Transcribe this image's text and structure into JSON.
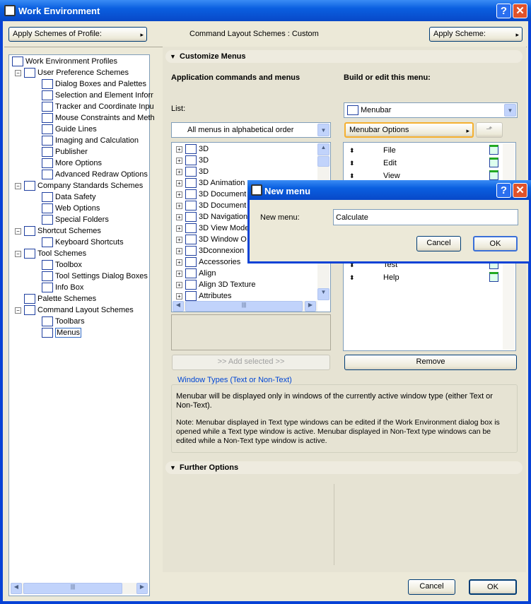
{
  "window": {
    "title": "Work Environment",
    "help": "?",
    "close": "✕"
  },
  "toolbar": {
    "apply_profile": "Apply Schemes of Profile:",
    "layout_status": "Command Layout Schemes : Custom",
    "apply_scheme": "Apply Scheme:"
  },
  "tree": {
    "items": [
      {
        "label": "Work Environment Profiles",
        "level": 0
      },
      {
        "label": "User Preference Schemes",
        "level": 1
      },
      {
        "label": "Dialog Boxes and Palettes",
        "level": 2
      },
      {
        "label": "Selection and Element Inforr",
        "level": 2
      },
      {
        "label": "Tracker and Coordinate Inpu",
        "level": 2
      },
      {
        "label": "Mouse Constraints and Meth",
        "level": 2
      },
      {
        "label": "Guide Lines",
        "level": 2
      },
      {
        "label": "Imaging and Calculation",
        "level": 2
      },
      {
        "label": "Publisher",
        "level": 2
      },
      {
        "label": "More Options",
        "level": 2
      },
      {
        "label": "Advanced Redraw Options",
        "level": 2
      },
      {
        "label": "Company Standards Schemes",
        "level": 1
      },
      {
        "label": "Data Safety",
        "level": 2
      },
      {
        "label": "Web Options",
        "level": 2
      },
      {
        "label": "Special Folders",
        "level": 2
      },
      {
        "label": "Shortcut Schemes",
        "level": 1
      },
      {
        "label": "Keyboard Shortcuts",
        "level": 2
      },
      {
        "label": "Tool Schemes",
        "level": 1
      },
      {
        "label": "Toolbox",
        "level": 2
      },
      {
        "label": "Tool Settings Dialog Boxes",
        "level": 2
      },
      {
        "label": "Info Box",
        "level": 2
      },
      {
        "label": "Palette Schemes",
        "level": 1
      },
      {
        "label": "Command Layout Schemes",
        "level": 1
      },
      {
        "label": "Toolbars",
        "level": 2
      },
      {
        "label": "Menus",
        "level": 2,
        "selected": true
      }
    ]
  },
  "customize": {
    "header": "Customize Menus",
    "left_title": "Application commands and menus",
    "right_title": "Build or edit this menu:",
    "list_label": "List:",
    "list_select": "All menus in alphabetical order",
    "commands": [
      "3D",
      "3D",
      "3D",
      "3D Animation",
      "3D Document",
      "3D Document",
      "3D Navigation",
      "3D View Mode",
      "3D Window O",
      "3Dconnexion",
      "Accessories",
      "Align",
      "Align 3D Texture",
      "Attributes"
    ],
    "add_selected": ">> Add selected >>",
    "menu_select": "Menubar",
    "menu_options": "Menubar Options",
    "menu_items_top": [
      "File",
      "Edit",
      "View"
    ],
    "menu_items_bottom": [
      "Test",
      "Help"
    ],
    "remove": "Remove",
    "group_title": "Window Types (Text or Non-Text)",
    "group_text1": "Menubar will be displayed only in windows of the currently active window type (either Text or Non-Text).",
    "group_text2": "Note: Menubar displayed in Text type windows can be edited if the Work Environment dialog box is opened while a Text type window is active. Menubar displayed in Non-Text type windows can be edited while a Non-Text type window is active."
  },
  "further": {
    "header": "Further Options"
  },
  "footer": {
    "cancel": "Cancel",
    "ok": "OK"
  },
  "dialog": {
    "title": "New menu",
    "label": "New menu:",
    "value": "Calculate",
    "cancel": "Cancel",
    "ok": "OK"
  },
  "colors": {
    "titlebar": "#0a5fe0",
    "face": "#ece9d8",
    "accent": "#f5b030"
  }
}
